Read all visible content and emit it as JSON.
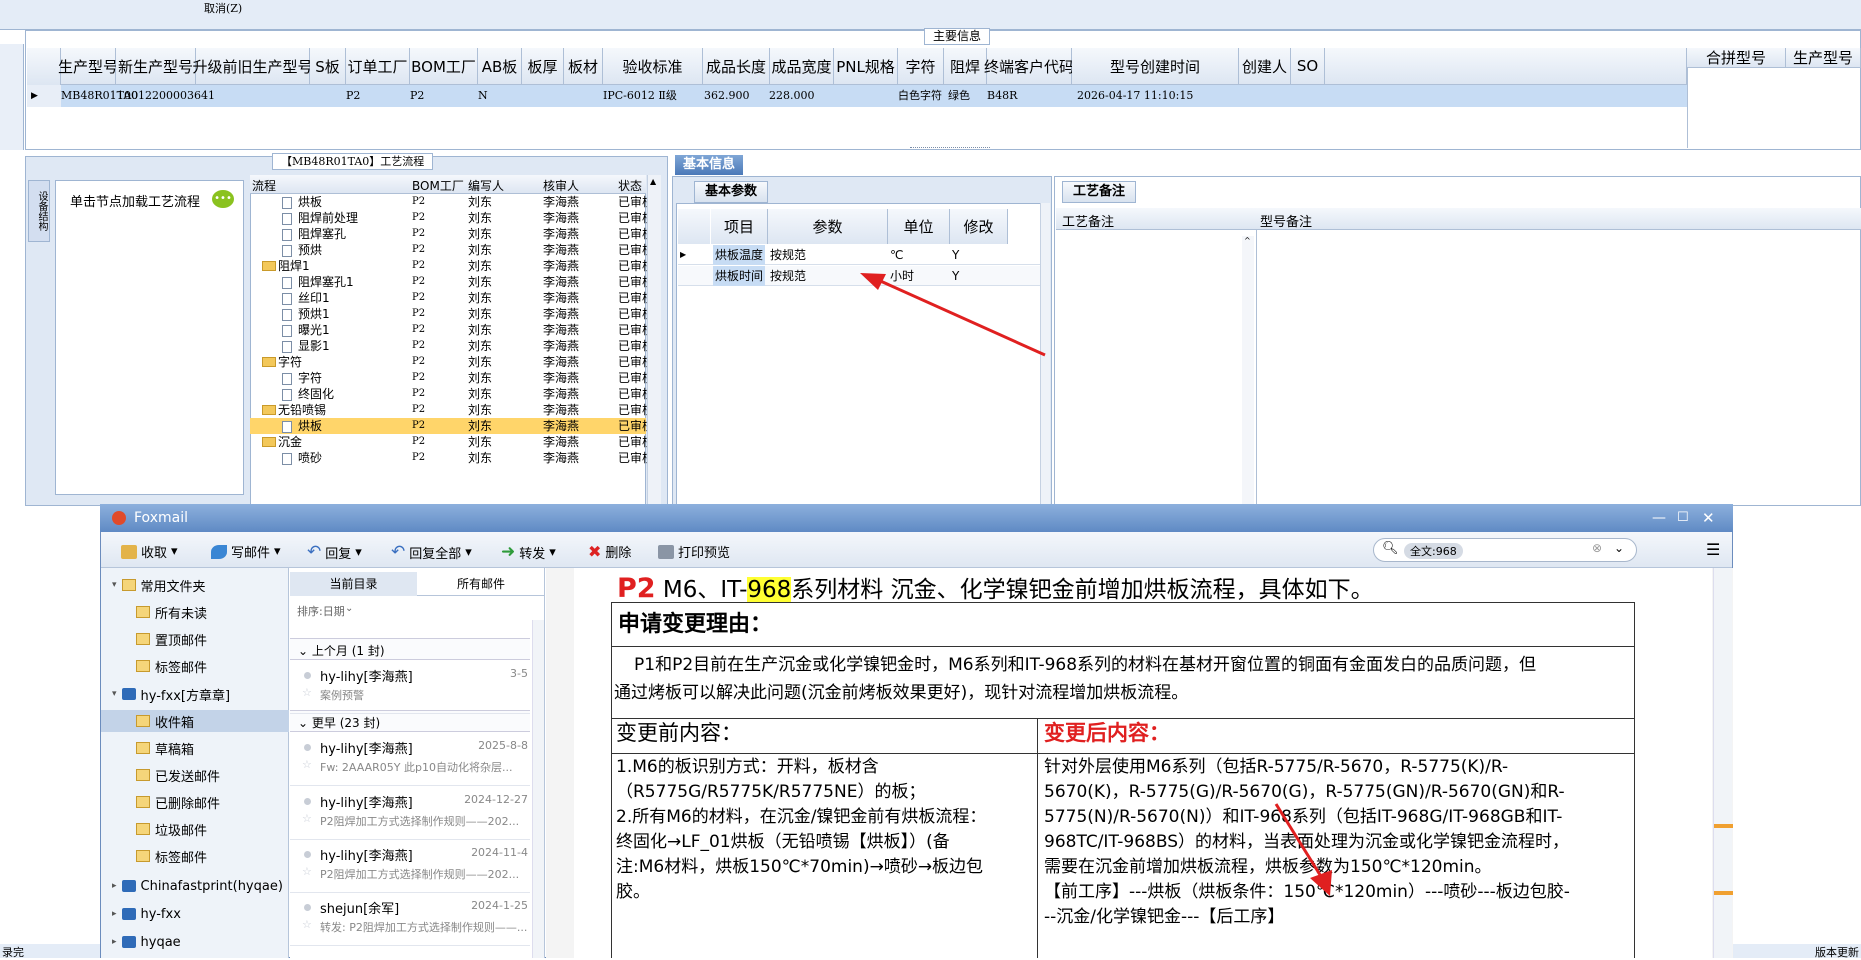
{
  "top": {
    "cancel_label": "取消(Z)",
    "main_info_label": "主要信息"
  },
  "grid": {
    "headers": [
      "生产型号",
      "新生产型号",
      "升级前旧生产型号",
      "S板",
      "订单工厂",
      "BOM工厂",
      "AB板",
      "板厚",
      "板材",
      "验收标准",
      "成品长度",
      "成品宽度",
      "PNL规格",
      "字符",
      "阻焊",
      "终端客户代码",
      "型号创建时间",
      "创建人",
      "SO"
    ],
    "right_headers": [
      "合拼型号",
      "生产型号"
    ],
    "row": [
      "MB48R01TA0",
      "10012200003641",
      "",
      "",
      "P2",
      "P2",
      "N",
      "",
      "",
      "IPC-6012 Ⅱ级",
      "362.900",
      "228.000",
      "",
      "白色字符",
      "绿色",
      "B48R",
      "2026-04-17 11:10:15",
      "",
      ""
    ]
  },
  "process": {
    "title": "【MB48R01TA0】工艺流程",
    "side_label": "设备结构",
    "load_hint": "单击节点加载工艺流程",
    "headers": [
      "流程",
      "BOM工厂",
      "编写人",
      "核审人",
      "状态"
    ],
    "rows": [
      {
        "name": "烘板",
        "bom": "P2",
        "writer": "刘东",
        "reviewer": "李海燕",
        "status": "已审核",
        "level": 2,
        "folder": false
      },
      {
        "name": "阻焊前处理",
        "bom": "P2",
        "writer": "刘东",
        "reviewer": "李海燕",
        "status": "已审核",
        "level": 2,
        "folder": false
      },
      {
        "name": "阻焊塞孔",
        "bom": "P2",
        "writer": "刘东",
        "reviewer": "李海燕",
        "status": "已审核",
        "level": 2,
        "folder": false
      },
      {
        "name": "预烘",
        "bom": "P2",
        "writer": "刘东",
        "reviewer": "李海燕",
        "status": "已审核",
        "level": 2,
        "folder": false
      },
      {
        "name": "阻焊1",
        "bom": "P2",
        "writer": "刘东",
        "reviewer": "李海燕",
        "status": "已审核",
        "level": 1,
        "folder": true
      },
      {
        "name": "阻焊塞孔1",
        "bom": "P2",
        "writer": "刘东",
        "reviewer": "李海燕",
        "status": "已审核",
        "level": 2,
        "folder": false
      },
      {
        "name": "丝印1",
        "bom": "P2",
        "writer": "刘东",
        "reviewer": "李海燕",
        "status": "已审核",
        "level": 2,
        "folder": false
      },
      {
        "name": "预烘1",
        "bom": "P2",
        "writer": "刘东",
        "reviewer": "李海燕",
        "status": "已审核",
        "level": 2,
        "folder": false
      },
      {
        "name": "曝光1",
        "bom": "P2",
        "writer": "刘东",
        "reviewer": "李海燕",
        "status": "已审核",
        "level": 2,
        "folder": false
      },
      {
        "name": "显影1",
        "bom": "P2",
        "writer": "刘东",
        "reviewer": "李海燕",
        "status": "已审核",
        "level": 2,
        "folder": false
      },
      {
        "name": "字符",
        "bom": "P2",
        "writer": "刘东",
        "reviewer": "李海燕",
        "status": "已审核",
        "level": 1,
        "folder": true
      },
      {
        "name": "字符",
        "bom": "P2",
        "writer": "刘东",
        "reviewer": "李海燕",
        "status": "已审核",
        "level": 2,
        "folder": false
      },
      {
        "name": "终固化",
        "bom": "P2",
        "writer": "刘东",
        "reviewer": "李海燕",
        "status": "已审核",
        "level": 2,
        "folder": false
      },
      {
        "name": "无铅喷锡",
        "bom": "P2",
        "writer": "刘东",
        "reviewer": "李海燕",
        "status": "已审核",
        "level": 1,
        "folder": true
      },
      {
        "name": "烘板",
        "bom": "P2",
        "writer": "刘东",
        "reviewer": "李海燕",
        "status": "已审核",
        "level": 2,
        "folder": false,
        "selected": true
      },
      {
        "name": "沉金",
        "bom": "P2",
        "writer": "刘东",
        "reviewer": "李海燕",
        "status": "已审核",
        "level": 1,
        "folder": true
      },
      {
        "name": "喷砂",
        "bom": "P2",
        "writer": "刘东",
        "reviewer": "李海燕",
        "status": "已审核",
        "level": 2,
        "folder": false
      }
    ]
  },
  "basic": {
    "tab": "基本信息",
    "sub_tab": "基本参数",
    "headers": [
      "项目",
      "参数",
      "单位",
      "修改"
    ],
    "rows": [
      [
        "烘板温度",
        "按规范",
        "℃",
        "Y"
      ],
      [
        "烘板时间",
        "按规范",
        "小时",
        "Y"
      ]
    ],
    "remark_tab": "工艺备注",
    "remark_cols": [
      "工艺备注",
      "型号备注"
    ]
  },
  "foxmail": {
    "title": "Foxmail",
    "toolbar": [
      "收取",
      "写邮件",
      "回复",
      "回复全部",
      "转发",
      "删除",
      "打印预览"
    ],
    "search": "全文:968",
    "folders": [
      {
        "label": "常用文件夹",
        "level": 0
      },
      {
        "label": "所有未读",
        "level": 1
      },
      {
        "label": "置顶邮件",
        "level": 1
      },
      {
        "label": "标签邮件",
        "level": 1
      },
      {
        "label": "hy-fxx[方章章]",
        "level": 0
      },
      {
        "label": "收件箱",
        "level": 1,
        "selected": true
      },
      {
        "label": "草稿箱",
        "level": 1
      },
      {
        "label": "已发送邮件",
        "level": 1
      },
      {
        "label": "已删除邮件",
        "level": 1
      },
      {
        "label": "垃圾邮件",
        "level": 1
      },
      {
        "label": "标签邮件",
        "level": 1
      },
      {
        "label": "Chinafastprint(hyqae)",
        "level": 0
      },
      {
        "label": "hy-fxx",
        "level": 0
      },
      {
        "label": "hyqae",
        "level": 0
      }
    ],
    "list_tabs": [
      "当前目录",
      "所有邮件"
    ],
    "sort": "排序:日期",
    "groups": [
      {
        "label": "上个月 (1 封)"
      },
      {
        "label": "更早 (23 封)"
      }
    ],
    "mails": [
      {
        "from": "hy-lihy[李海燕]",
        "date": "3-5",
        "subject": "案例预警"
      },
      {
        "from": "hy-lihy[李海燕]",
        "date": "2025-8-8",
        "subject": "Fw: 2AAAR05Y  此p10自动化将杂层..."
      },
      {
        "from": "hy-lihy[李海燕]",
        "date": "2024-12-27",
        "subject": "P2阻焊加工方式选择制作规则——202..."
      },
      {
        "from": "hy-lihy[李海燕]",
        "date": "2024-11-4",
        "subject": "P2阻焊加工方式选择制作规则——202..."
      },
      {
        "from": "shejun[余军]",
        "date": "2024-1-25",
        "subject": "转发: P2阻焊加工方式选择制作规则——..."
      }
    ],
    "body": {
      "headline_prefix": "P2",
      "headline_a": " M6、IT-",
      "headline_hl": "968",
      "headline_b": "系列材料 沉金、化学镍钯金前增加烘板流程，具体如下。",
      "reason_title": "申请变更理由：",
      "reason_line1": "P1和P2目前在生产沉金或化学镍钯金时，M6系列和IT-968系列的材料在基材开窗位置的铜面有金面发白的品质问题，但",
      "reason_line2": "通过烤板可以解决此问题(沉金前烤板效果更好)，现针对流程增加烘板流程。",
      "before_title": "变更前内容：",
      "after_title": "变更后内容：",
      "before_lines": [
        "1.M6的板识别方式：开料，板材含",
        "（R5775G/R5775K/R5775NE）的板；",
        "2.所有M6的材料，在沉金/镍钯金前有烘板流程：",
        "终固化→LF_01烘板（无铅喷锡【烘板】）(备",
        "注:M6材料，烘板150℃*70min)→喷砂→板边包",
        "胶。"
      ],
      "after_lines": [
        "针对外层使用M6系列（包括R-5775/R-5670，R-5775(K)/R-",
        "5670(K)，R-5775(G)/R-5670(G)，R-5775(GN)/R-5670(GN)和R-",
        "5775(N)/R-5670(N)）和IT-968系列（包括IT-968G/IT-968GB和IT-",
        "968TC/IT-968BS）的材料，当表面处理为沉金或化学镍钯金流程时，",
        "需要在沉金前增加烘板流程，烘板参数为150℃*120min。",
        "【前工序】---烘板（烘板条件：150℃*120min）---喷砂---板边包胶-",
        "--沉金/化学镍钯金---【后工序】"
      ]
    }
  },
  "status": {
    "left": "录完",
    "right": "版本更新"
  },
  "colors": {
    "accent": "#4b79b8",
    "selected_row": "#c7dcf4",
    "tree_sel": "#ffd56a",
    "arrow": "#e02020",
    "red_text": "#e02020"
  }
}
